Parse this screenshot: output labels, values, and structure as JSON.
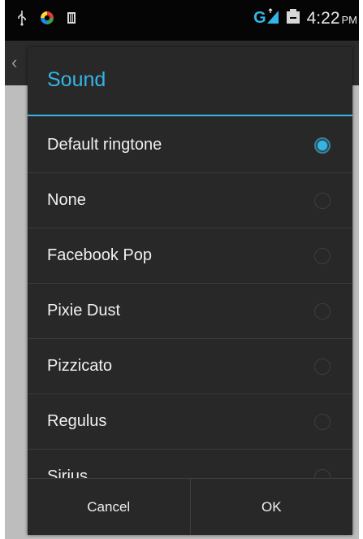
{
  "status_bar": {
    "left_icons": [
      "usb-icon",
      "app-notification-icon",
      "sim-icon"
    ],
    "network_label": "G",
    "right_icons": [
      "signal-icon",
      "battery-icon"
    ],
    "time": "4:22",
    "ampm": "PM"
  },
  "background": {
    "back_icon": "chevron-left-icon",
    "back_glyph": "‹"
  },
  "dialog": {
    "title": "Sound",
    "accent_color": "#35b5e5",
    "options": [
      {
        "label": "Default ringtone",
        "selected": true
      },
      {
        "label": "None",
        "selected": false
      },
      {
        "label": "Facebook Pop",
        "selected": false
      },
      {
        "label": "Pixie Dust",
        "selected": false
      },
      {
        "label": "Pizzicato",
        "selected": false
      },
      {
        "label": "Regulus",
        "selected": false
      },
      {
        "label": "Sirius",
        "selected": false
      }
    ],
    "cancel_label": "Cancel",
    "ok_label": "OK"
  }
}
